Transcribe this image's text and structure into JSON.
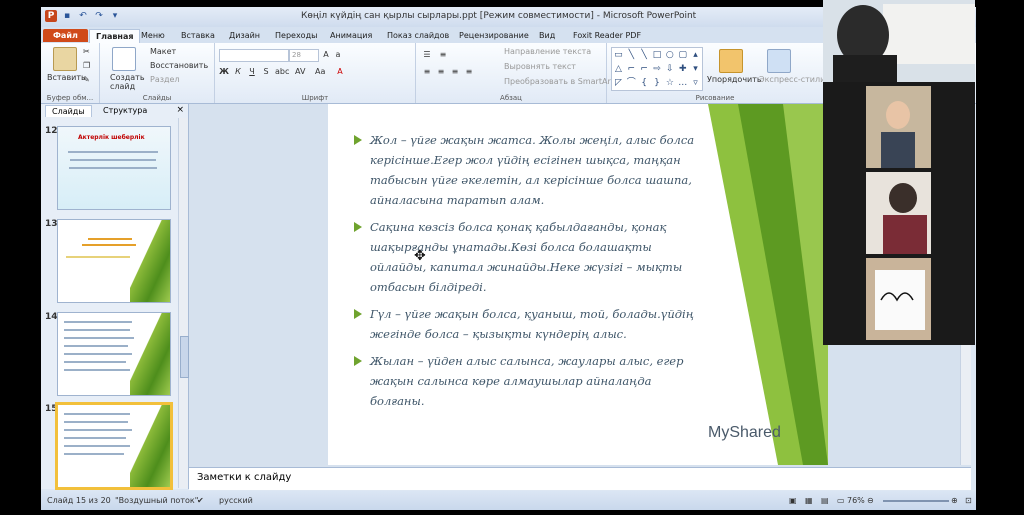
{
  "window": {
    "title": "Көңіл күйдің сан қырлы сырлары.ppt [Режим совместимости] - Microsoft PowerPoint"
  },
  "ribbon_tabs": [
    "Файл",
    "Главная",
    "Меню",
    "Вставка",
    "Дизайн",
    "Переходы",
    "Анимация",
    "Показ слайдов",
    "Рецензирование",
    "Вид",
    "Foxit Reader PDF"
  ],
  "ribbon": {
    "clipboard": {
      "paste": "Вставить",
      "label": "Буфер обм..."
    },
    "slides": {
      "create": "Создать слайд",
      "layout": "Макет",
      "reset": "Восстановить",
      "section": "Раздел",
      "label": "Слайды"
    },
    "font": {
      "size": "28",
      "label": "Шрифт"
    },
    "paragraph": {
      "direction": "Направление текста",
      "align": "Выровнять текст",
      "smartart": "Преобразовать в SmartArt",
      "label": "Абзац"
    },
    "drawing": {
      "arrange": "Упорядочить",
      "quick_styles": "Экспресс-стили",
      "label": "Рисование"
    }
  },
  "panel": {
    "tab_slides": "Слайды",
    "tab_outline": "Структура",
    "close": "×"
  },
  "thumbnails": [
    {
      "number": "12",
      "title": "Актерлік шеберлік"
    },
    {
      "number": "13",
      "title": ""
    },
    {
      "number": "14",
      "title": ""
    },
    {
      "number": "15",
      "title": ""
    }
  ],
  "slide": {
    "bullets": [
      "Жол – үйге жақын жатса. Жолы жеңіл, алыс болса керісінше.Егер жол үйдің есігінен шықса, таңқан табысын үйге әкелетін, ал керісінше болса шашпа, айналасына таратып алам.",
      "Сақина көзсіз болса қонақ қабылдағанды, қонақ шақырғанды ұнатады.Көзі болса болашақты ойлайды, капитал жинайды.Неке жүзігі – мықты отбасын білдіреді.",
      "Гүл – үйге жақын болса, қуаныш, той, болады.үйдің жегінде болса – қызықты күндерің алыс.",
      "Жылан – үйден алыс салынса, жаулары алыс, егер жақын салынса көре алмаушылар айналаңда болғаны."
    ],
    "watermark": "MyShared"
  },
  "notes": {
    "placeholder": "Заметки к слайду"
  },
  "status": {
    "slide_counter": "Слайд 15 из 20",
    "theme": "\"Воздушный поток\"",
    "language": "русский",
    "zoom": "76%"
  },
  "colors": {
    "accent_green": "#6fa32e",
    "file_tab": "#d04a1a"
  }
}
